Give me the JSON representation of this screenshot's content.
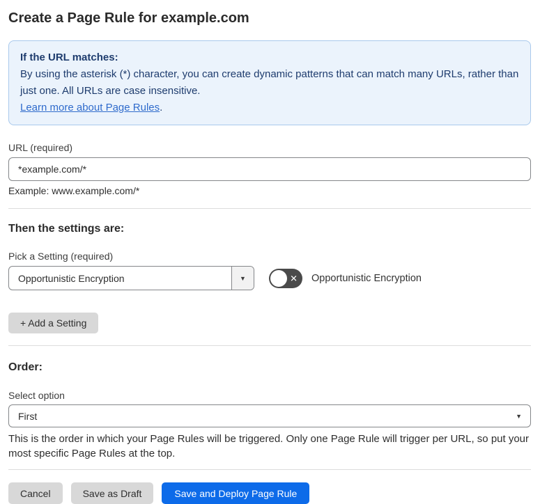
{
  "page": {
    "title": "Create a Page Rule for example.com"
  },
  "info_box": {
    "heading": "If the URL matches:",
    "body": "By using the asterisk (*) character, you can create dynamic patterns that can match many URLs, rather than just one. All URLs are case insensitive.",
    "link_label": "Learn more about Page Rules",
    "link_suffix": "."
  },
  "url_field": {
    "label": "URL (required)",
    "value": "*example.com/*",
    "hint": "Example: www.example.com/*"
  },
  "settings_section": {
    "heading": "Then the settings are:",
    "picker_label": "Pick a Setting (required)",
    "selected_setting": "Opportunistic Encryption",
    "toggle": {
      "state": "off",
      "label": "Opportunistic Encryption"
    },
    "add_button_label": "+ Add a Setting"
  },
  "order_section": {
    "heading": "Order:",
    "select_label": "Select option",
    "selected_option": "First",
    "description": "This is the order in which your Page Rules will be triggered. Only one Page Rule will trigger per URL, so put your most specific Page Rules at the top."
  },
  "actions": {
    "cancel_label": "Cancel",
    "save_draft_label": "Save as Draft",
    "save_deploy_label": "Save and Deploy Page Rule"
  },
  "icons": {
    "dropdown_arrow": "▼",
    "select_arrow": "▼",
    "toggle_off_glyph": "✕"
  },
  "colors": {
    "info_bg": "#EBF3FC",
    "info_border": "#A9C9EC",
    "info_text": "#1E3C6E",
    "link_blue": "#2F6BCC",
    "primary_button_blue": "#0D6BE9",
    "gray_button": "#D8D8D8",
    "toggle_off_gray": "#4A4A4A"
  }
}
